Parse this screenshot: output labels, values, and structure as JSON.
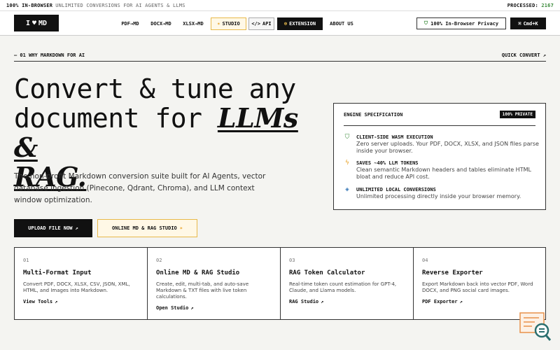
{
  "topbar": {
    "left_bold": "100% IN-BROWSER",
    "left_muted": "UNLIMITED CONVERSIONS FOR AI AGENTS & LLMS",
    "processed_label": "PROCESSED:",
    "processed_count": "2167"
  },
  "nav": {
    "logo_left": "I",
    "logo_icon": "heart-icon",
    "logo_right": "MD",
    "links": [
      "PDF→MD",
      "DOCX→MD",
      "XLSX→MD",
      "STUDIO",
      "API",
      "EXTENSION",
      "ABOUT US"
    ],
    "privacy": "100% In-Browser Privacy",
    "cmdk": "Cmd+K"
  },
  "section": {
    "label": "— 01 WHY MARKDOWN FOR AI",
    "quick_convert": "QUICK CONVERT"
  },
  "hero": {
    "title_part1": "Convert & tune any document for ",
    "title_ital1": "LLMs &",
    "title_ital2": "RAG.",
    "description": "The non-profit Markdown conversion suite built for AI Agents, vector database ingestion (Pinecone, Qdrant, Chroma), and LLM context window optimization.",
    "btn_upload": "UPLOAD FILE NOW",
    "btn_studio": "ONLINE MD & RAG STUDIO"
  },
  "spec": {
    "heading": "ENGINE SPECIFICATION",
    "badge": "100% PRIVATE",
    "items": [
      {
        "title": "CLIENT-SIDE WASM EXECUTION",
        "text": "Zero server uploads. Your PDF, DOCX, XLSX, and JSON files parse inside your browser."
      },
      {
        "title": "SAVES ~40% LLM TOKENS",
        "text": "Clean semantic Markdown headers and tables eliminate HTML bloat and reduce API cost."
      },
      {
        "title": "UNLIMITED LOCAL CONVERSIONS",
        "text": "Unlimited processing directly inside your browser memory."
      }
    ]
  },
  "cards": [
    {
      "num": "01",
      "title": "Multi-Format Input",
      "text": "Convert PDF, DOCX, XLSX, CSV, JSON, XML, HTML, and Images into Markdown.",
      "link": "View Tools"
    },
    {
      "num": "02",
      "title": "Online MD & RAG Studio",
      "text": "Create, edit, multi-tab, and auto-save Markdown & TXT files with live token calculations.",
      "link": "Open Studio"
    },
    {
      "num": "03",
      "title": "RAG Token Calculator",
      "text": "Real-time token count estimation for GPT-4, Claude, and Llama models.",
      "link": "RAG Studio"
    },
    {
      "num": "04",
      "title": "Reverse Exporter",
      "text": "Export Markdown back into vector PDF, Word DOCX, and PNG social card images.",
      "link": "PDF Exporter"
    }
  ],
  "colors": {
    "accent_gold": "#e8b94a",
    "accent_green": "#3a8a3a",
    "dark": "#111111"
  }
}
